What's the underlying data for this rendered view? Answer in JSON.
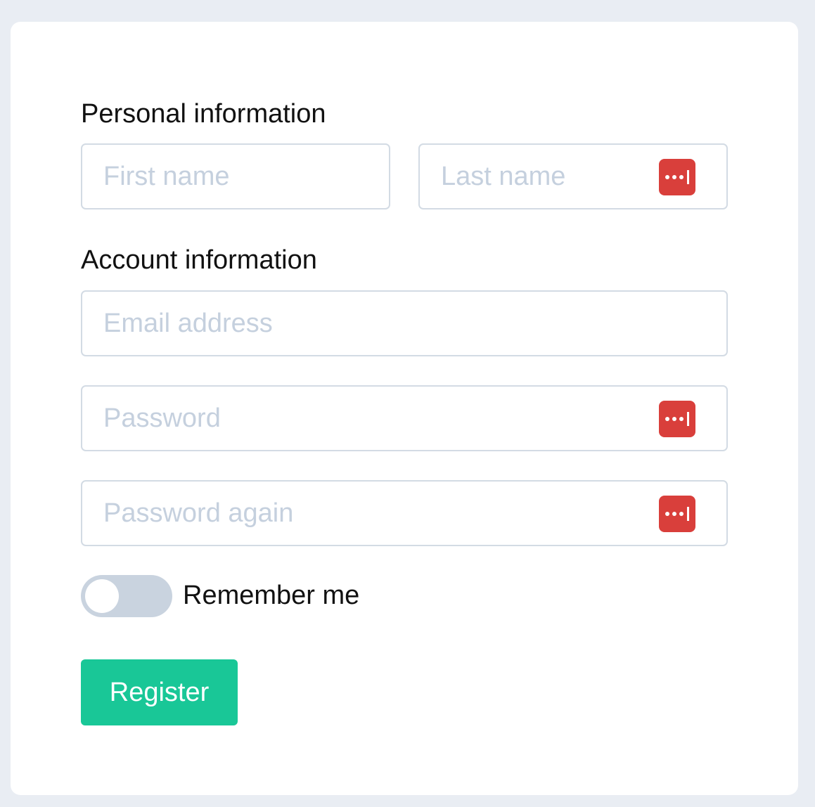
{
  "personal": {
    "title": "Personal information",
    "first_name_placeholder": "First name",
    "last_name_placeholder": "Last name"
  },
  "account": {
    "title": "Account information",
    "email_placeholder": "Email address",
    "password_placeholder": "Password",
    "password_again_placeholder": "Password again"
  },
  "remember": {
    "label": "Remember me",
    "checked": false
  },
  "register_label": "Register",
  "icons": {
    "password_manager": "password-manager-icon"
  },
  "colors": {
    "background": "#e9edf3",
    "card": "#ffffff",
    "field_border": "#d3dbe4",
    "placeholder": "#c5d0de",
    "password_manager_icon": "#d93f3b",
    "toggle_off": "#c9d3df",
    "register_button": "#19c797"
  }
}
